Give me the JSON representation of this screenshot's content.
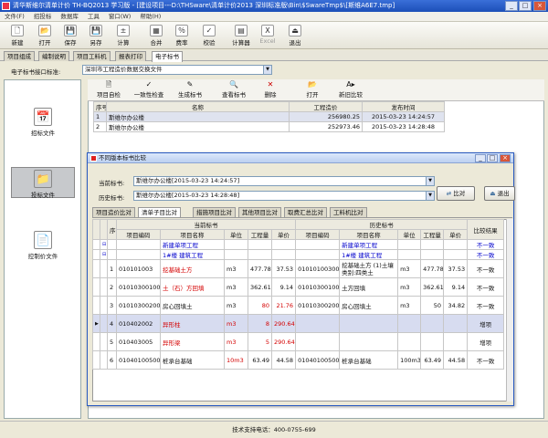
{
  "window": {
    "title": "清华斯维尔清单计价 TH-BQ2013 学习版 - [建设项目---D:\\THSware\\清单计价2013 深圳标准版\\Bin\\$SwareTmp$\\[斯维A6E7.tmp]"
  },
  "menu": [
    "文件(F)",
    "招投标",
    "数据库",
    "工具",
    "窗口(W)",
    "帮助(H)"
  ],
  "toolbar": {
    "new": "新建",
    "open": "打开",
    "save": "保存",
    "save_as": "另存",
    "calc": "计算",
    "merge": "合并",
    "rate": "费率",
    "check": "校验",
    "calculator": "计算器",
    "excel": "Excel",
    "exit": "退出"
  },
  "main_tabs": [
    "项目组成",
    "编制说明",
    "项目工料机",
    "报表打印",
    "电子标书"
  ],
  "interface_label": "电子标书接口标准:",
  "interface_value": "深圳市工程造价数据交换文件",
  "left_panel": {
    "bid_file": "招标文件",
    "tender_file": "投标文件",
    "control_file": "控制价文件"
  },
  "subtoolbar": {
    "project_check": "项目自检",
    "consistency_check": "一致性检查",
    "gen_bid": "生成标书",
    "view_bid": "查看标书",
    "delete": "删除",
    "open": "打开",
    "compare": "新旧比较"
  },
  "list": {
    "headers": [
      "序号",
      "名称",
      "工程造价",
      "发布时间"
    ],
    "rows": [
      [
        "1",
        "斯维尔办公楼",
        "256980.25",
        "2015-03-23 14:24:57"
      ],
      [
        "2",
        "斯维尔办公楼",
        "252973.46",
        "2015-03-23 14:28:48"
      ]
    ]
  },
  "dialog": {
    "title": "不同版本标书比较",
    "current_label": "当前标书:",
    "current_value": "斯维尔办公楼[2015-03-23 14:24:57]",
    "history_label": "历史标书:",
    "history_value": "斯维尔办公楼[2015-03-23 14:28:48]",
    "compare_btn": "比对",
    "exit_btn": "退出",
    "tabs": [
      "项目造价比对",
      "清单子目比对",
      "措施项目比对",
      "其他项目比对",
      "取费汇总比对",
      "工料机比对"
    ],
    "group_current": "当前标书",
    "group_history": "历史标书",
    "col_seq": "序号",
    "col_result": "比较结果",
    "sub_headers": [
      "项目编码",
      "项目名称",
      "单位",
      "工程量",
      "单价"
    ],
    "rows": [
      {
        "seq": "",
        "c": [
          "",
          "新建单项工程",
          "",
          "",
          ""
        ],
        "h": [
          "",
          "新建单项工程",
          "",
          "",
          ""
        ],
        "r": "不一致",
        "type": "blue"
      },
      {
        "seq": "",
        "c": [
          "",
          "1#楼 建筑工程",
          "",
          "",
          ""
        ],
        "h": [
          "",
          "1#楼 建筑工程",
          "",
          "",
          ""
        ],
        "r": "不一致",
        "type": "blue"
      },
      {
        "seq": "1",
        "c": [
          "010101003",
          "挖基础土方",
          "m3",
          "477.78",
          "37.53"
        ],
        "h": [
          "010101003001",
          "挖基础土方 (1)土壤类别:四类土",
          "m3",
          "477.78",
          "37.53"
        ],
        "r": "不一致",
        "type": "namediff"
      },
      {
        "seq": "2",
        "c": [
          "010103001001",
          "土（石）方回填",
          "m3",
          "362.61",
          "9.14"
        ],
        "h": [
          "010103001001",
          "土方回填",
          "m3",
          "362.61",
          "9.14"
        ],
        "r": "不一致",
        "type": "namediff"
      },
      {
        "seq": "3",
        "c": [
          "010103002001",
          "房心回填土",
          "m3",
          "80",
          "21.76"
        ],
        "h": [
          "010103002001",
          "房心回填土",
          "m3",
          "50",
          "34.82"
        ],
        "r": "不一致",
        "type": "qtydiff"
      },
      {
        "seq": "4",
        "c": [
          "010402002",
          "异形柱",
          "m3",
          "8",
          "290.64"
        ],
        "h": [
          "",
          "",
          "",
          "",
          ""
        ],
        "r": "增项",
        "type": "add"
      },
      {
        "seq": "5",
        "c": [
          "010403005",
          "异形梁",
          "m3",
          "5",
          "290.64"
        ],
        "h": [
          "",
          "",
          "",
          "",
          ""
        ],
        "r": "增项",
        "type": "add2"
      },
      {
        "seq": "6",
        "c": [
          "010401005001",
          "桩承台基础",
          "10m3",
          "63.49",
          "44.58"
        ],
        "h": [
          "010401005001",
          "桩承台基础",
          "100m3",
          "63.49",
          "44.58"
        ],
        "r": "不一致",
        "type": "unitdiff"
      }
    ]
  },
  "status": "技术支持电话：400-0755-699"
}
